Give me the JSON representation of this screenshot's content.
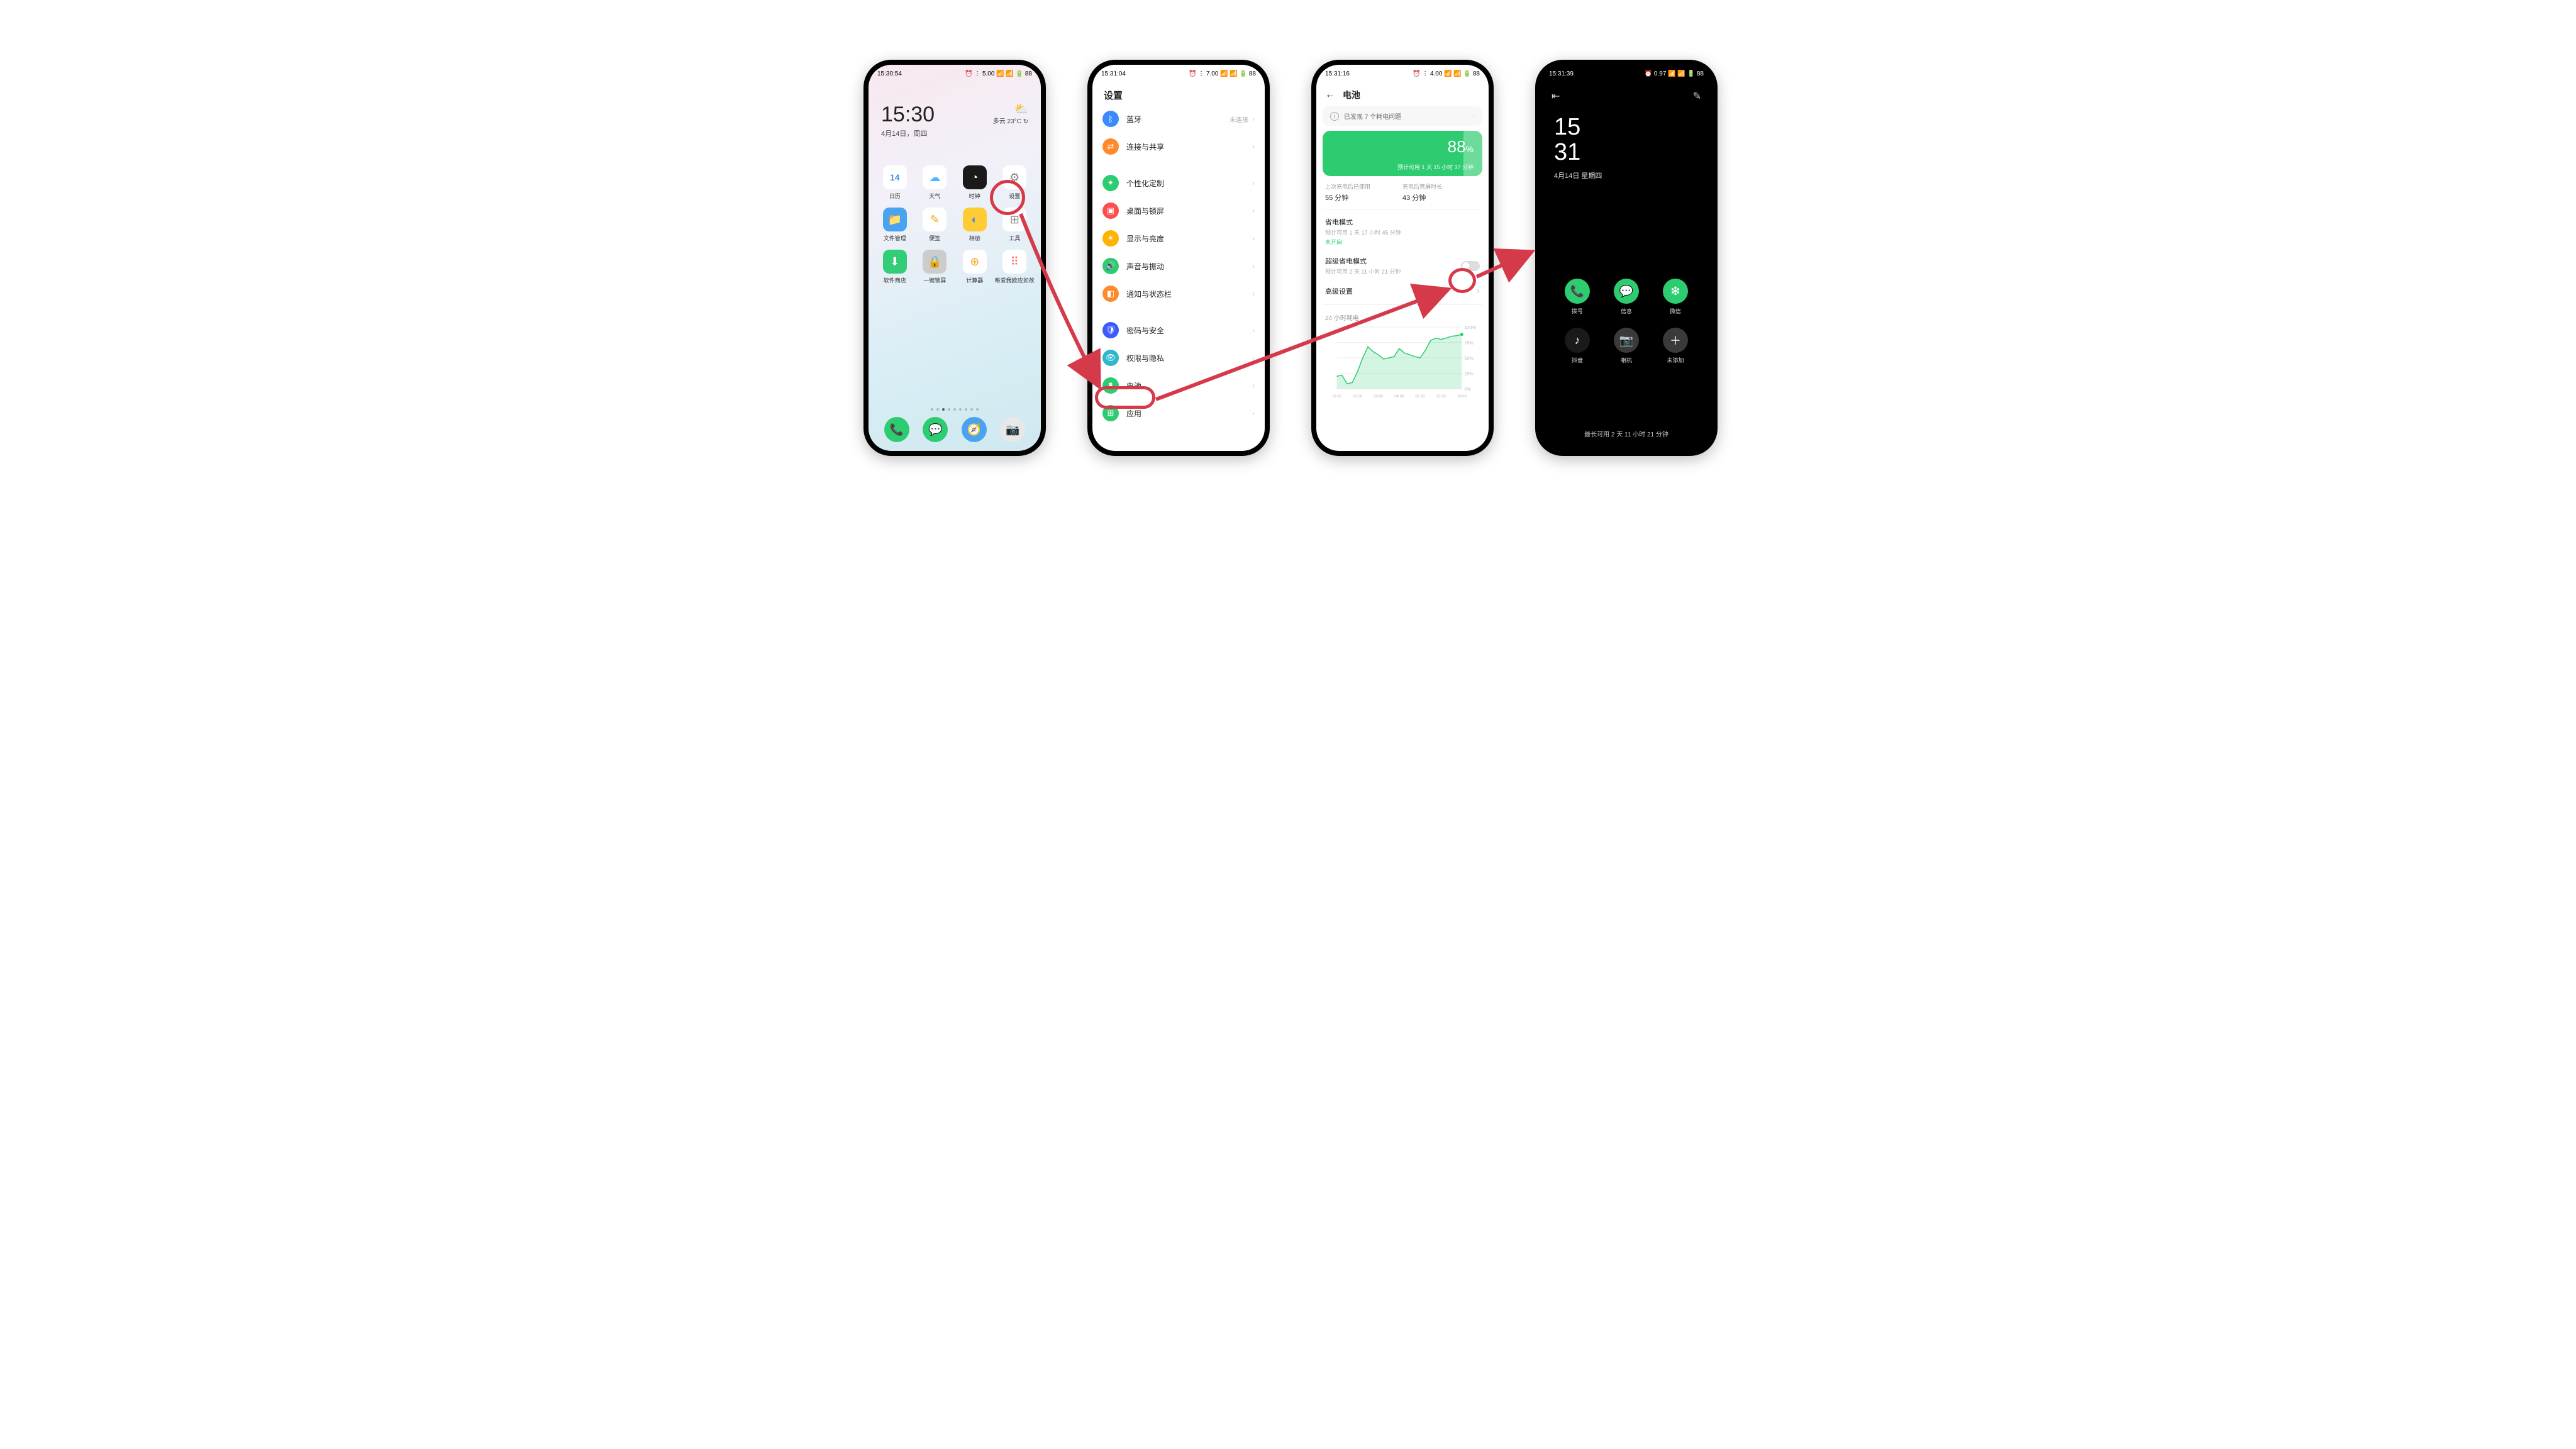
{
  "phone1": {
    "status_time": "15:30:54",
    "status_right": "⏰ ⋮ 5.00 📶 📶 🔋 88",
    "clock_time": "15:30",
    "clock_date": "4月14日，周四",
    "weather_icon": "⛅",
    "weather_text": "多云 23°C ↻",
    "apps": [
      {
        "label": "日历",
        "bg": "#ffffff",
        "glyph": "14",
        "fg": "#4a90e2",
        "shape": "text"
      },
      {
        "label": "天气",
        "bg": "#ffffff",
        "glyph": "☁",
        "fg": "#4db8ff"
      },
      {
        "label": "时钟",
        "bg": "#1a1a1a",
        "glyph": "◔",
        "fg": "#fff"
      },
      {
        "label": "设置",
        "bg": "#ffffff",
        "glyph": "⚙",
        "fg": "#888"
      },
      {
        "label": "文件管理",
        "bg": "#4aa3f0",
        "glyph": "📁",
        "fg": "#fff"
      },
      {
        "label": "便签",
        "bg": "#ffffff",
        "glyph": "✎",
        "fg": "#f5a623"
      },
      {
        "label": "相册",
        "bg": "#ffcc33",
        "glyph": "◐",
        "fg": "#4a90e2"
      },
      {
        "label": "工具",
        "bg": "#ffffff",
        "glyph": "⊞",
        "fg": "#888"
      },
      {
        "label": "软件商店",
        "bg": "#33cc77",
        "glyph": "⬇",
        "fg": "#fff"
      },
      {
        "label": "一键锁屏",
        "bg": "#cccccc",
        "glyph": "🔒",
        "fg": "#fff"
      },
      {
        "label": "计算器",
        "bg": "#ffffff",
        "glyph": "⊕",
        "fg": "#f5a623"
      },
      {
        "label": "唯爱我欧应如故",
        "bg": "#ffffff",
        "glyph": "⠿",
        "fg": "#ff6b6b"
      }
    ],
    "dock": [
      {
        "bg": "#2ecc71",
        "glyph": "📞"
      },
      {
        "bg": "#2ecc71",
        "glyph": "💬"
      },
      {
        "bg": "#4aa3f0",
        "glyph": "🧭"
      },
      {
        "bg": "#e8e8e8",
        "glyph": "📷"
      }
    ]
  },
  "phone2": {
    "status_time": "15:31:04",
    "status_right": "⏰ ⋮ 7.00 📶 📶 🔋 88",
    "title": "设置",
    "rows": [
      {
        "icon_bg": "#3b8bff",
        "glyph": "ᛒ",
        "label": "蓝牙",
        "value": "未连接"
      },
      {
        "icon_bg": "#ff8a2b",
        "glyph": "⇄",
        "label": "连接与共享",
        "value": ""
      },
      {
        "gap": true
      },
      {
        "icon_bg": "#2ecc71",
        "glyph": "✦",
        "label": "个性化定制",
        "value": ""
      },
      {
        "icon_bg": "#ff4d4d",
        "glyph": "▣",
        "label": "桌面与锁屏",
        "value": ""
      },
      {
        "icon_bg": "#ffb300",
        "glyph": "☀",
        "label": "显示与亮度",
        "value": ""
      },
      {
        "icon_bg": "#2ecc71",
        "glyph": "🔊",
        "label": "声音与振动",
        "value": ""
      },
      {
        "icon_bg": "#ff8a2b",
        "glyph": "◧",
        "label": "通知与状态栏",
        "value": ""
      },
      {
        "gap": true
      },
      {
        "icon_bg": "#3b5bff",
        "glyph": "🛡",
        "label": "密码与安全",
        "value": ""
      },
      {
        "icon_bg": "#2eb8cc",
        "glyph": "👁",
        "label": "权限与隐私",
        "value": ""
      },
      {
        "icon_bg": "#2ecc71",
        "glyph": "▮",
        "label": "电池",
        "value": ""
      },
      {
        "icon_bg": "#2ecc71",
        "glyph": "⊞",
        "label": "应用",
        "value": ""
      }
    ]
  },
  "phone3": {
    "status_time": "15:31:16",
    "status_right": "⏰ ⋮ 4.00 📶 📶 🔋 88",
    "title": "电池",
    "notice": "已发现 7 个耗电问题",
    "battery_pct": "88",
    "battery_est": "预计可用 1 天 15 小时 37 分钟",
    "since_label": "上次充电后已使用",
    "since_value": "55 分钟",
    "screen_label": "充电后亮屏时长",
    "screen_value": "43 分钟",
    "save_mode_title": "省电模式",
    "save_mode_sub": "预计可用 1 天 17 小时 45 分钟",
    "save_mode_status": "未开启",
    "super_save_title": "超级省电模式",
    "super_save_sub": "预计可用 2 天 11 小时 21 分钟",
    "advanced": "高级设置",
    "chart_title": "24 小时耗电"
  },
  "phone4": {
    "status_time": "15:31:39",
    "status_right": "⏰ 0.97 📶 📶 🔋 88",
    "clock_h": "15",
    "clock_m": "31",
    "date": "4月14日 星期四",
    "apps": [
      {
        "bg": "#2ecc71",
        "glyph": "📞",
        "label": "拨号"
      },
      {
        "bg": "#2ecc71",
        "glyph": "💬",
        "label": "信息"
      },
      {
        "bg": "#2ecc71",
        "glyph": "❇",
        "label": "微信"
      },
      {
        "bg": "#1a1a1a",
        "glyph": "♪",
        "label": "抖音"
      },
      {
        "bg": "#3a3a3a",
        "glyph": "📷",
        "label": "相机"
      },
      {
        "bg": "#3a3a3a",
        "glyph": "＋",
        "label": "未添加"
      }
    ],
    "footer": "最长可用 2 天 11 小时 21 分钟"
  },
  "chart_data": {
    "type": "area",
    "xlabel": "",
    "ylabel": "%",
    "ylim": [
      0,
      100
    ],
    "x_ticks": [
      "16:00",
      "20:00",
      "00:00",
      "04:00",
      "08:00",
      "12:00",
      "16:00"
    ],
    "y_ticks": [
      0,
      25,
      50,
      75,
      100
    ],
    "x": [
      16,
      17,
      18,
      19,
      20,
      21,
      22,
      23,
      0,
      1,
      2,
      3,
      4,
      5,
      6,
      7,
      8,
      9,
      10,
      11,
      12,
      13,
      14,
      15,
      16
    ],
    "values": [
      20,
      22,
      8,
      10,
      28,
      50,
      68,
      60,
      55,
      48,
      50,
      52,
      65,
      58,
      55,
      52,
      50,
      62,
      78,
      82,
      80,
      82,
      85,
      86,
      88
    ]
  }
}
